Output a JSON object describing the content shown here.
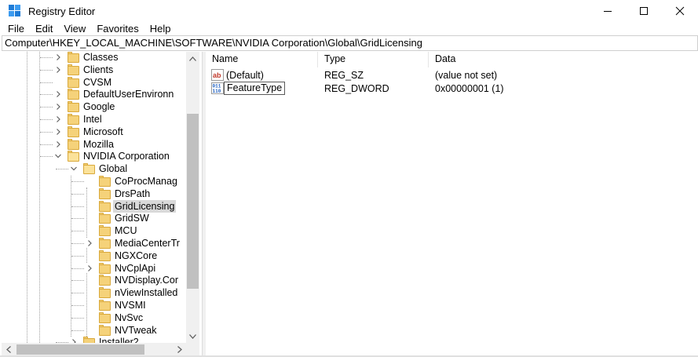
{
  "window": {
    "title": "Registry Editor",
    "icon": "registry-editor-icon"
  },
  "menu": [
    "File",
    "Edit",
    "View",
    "Favorites",
    "Help"
  ],
  "address": "Computer\\HKEY_LOCAL_MACHINE\\SOFTWARE\\NVIDIA Corporation\\Global\\GridLicensing",
  "tree": {
    "items": [
      {
        "label": "Classes",
        "expander": "collapsed"
      },
      {
        "label": "Clients",
        "expander": "collapsed"
      },
      {
        "label": "CVSM",
        "expander": "none"
      },
      {
        "label": "DefaultUserEnvironn",
        "expander": "collapsed"
      },
      {
        "label": "Google",
        "expander": "collapsed"
      },
      {
        "label": "Intel",
        "expander": "collapsed"
      },
      {
        "label": "Microsoft",
        "expander": "collapsed"
      },
      {
        "label": "Mozilla",
        "expander": "collapsed"
      },
      {
        "label": "NVIDIA Corporation",
        "expander": "expanded"
      },
      {
        "label": "Global",
        "expander": "expanded"
      },
      {
        "label": "CoProcManag",
        "expander": "none"
      },
      {
        "label": "DrsPath",
        "expander": "none"
      },
      {
        "label": "GridLicensing",
        "expander": "none",
        "selected": true
      },
      {
        "label": "GridSW",
        "expander": "none"
      },
      {
        "label": "MCU",
        "expander": "none"
      },
      {
        "label": "MediaCenterTr",
        "expander": "collapsed"
      },
      {
        "label": "NGXCore",
        "expander": "none"
      },
      {
        "label": "NvCplApi",
        "expander": "collapsed"
      },
      {
        "label": "NVDisplay.Cor",
        "expander": "none"
      },
      {
        "label": "nViewInstalled",
        "expander": "none"
      },
      {
        "label": "NVSMI",
        "expander": "none"
      },
      {
        "label": "NvSvc",
        "expander": "none"
      },
      {
        "label": "NVTweak",
        "expander": "none"
      },
      {
        "label": "Installer2",
        "expander": "collapsed"
      }
    ]
  },
  "list": {
    "columns": [
      "Name",
      "Type",
      "Data"
    ],
    "rows": [
      {
        "name": "(Default)",
        "type": "REG_SZ",
        "data": "(value not set)",
        "icon": "string-value-icon"
      },
      {
        "name": "FeatureType",
        "type": "REG_DWORD",
        "data": "0x00000001 (1)",
        "icon": "binary-value-icon"
      }
    ]
  },
  "colors": {
    "selection": "#d9d9d9",
    "folder": "#f5d27a",
    "scrollbar": "#f0f0f0",
    "thumb": "#c0c0c0"
  }
}
